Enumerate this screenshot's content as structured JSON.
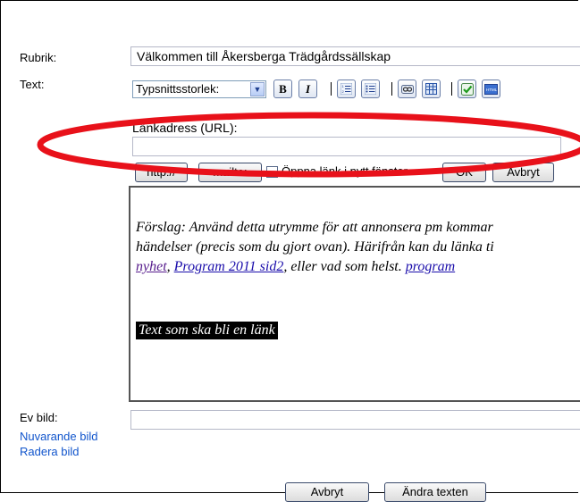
{
  "form": {
    "rubrik_label": "Rubrik:",
    "rubrik_value": "Välkommen till Åkersberga Trädgårdssällskap",
    "text_label": "Text:",
    "ev_bild_label": "Ev bild:",
    "nuvarande_bild_link": "Nuvarande bild",
    "radera_bild_link": "Radera bild",
    "ev_bild_value": ""
  },
  "toolbar": {
    "font_size_select": "Typsnittsstorlek:",
    "bold_label": "B",
    "italic_label": "I",
    "icons": [
      "ordered-list-icon",
      "unordered-list-icon",
      "link-icon",
      "table-icon",
      "check-icon",
      "html-icon"
    ]
  },
  "link_dialog": {
    "url_label": "Länkadress (URL):",
    "url_value": "",
    "http_button": "http://",
    "mailto_button": "mailto:",
    "new_window_label": "Öppna länk i nytt fönster",
    "ok_button": "OK",
    "cancel_button": "Avbryt"
  },
  "editor": {
    "line1": "Förslag: Använd detta utrymme för att annonsera pm kommar",
    "line2": "händelser (precis som du gjort ovan). Härifrån kan du länka ti",
    "link_nyhet": "nyhet",
    "sep1": ", ",
    "link_program2011": "Program 2011 sid2",
    "mid_text": ", eller vad som helst. ",
    "link_program": "program",
    "selected_text": "Text som ska bli en länk"
  },
  "footer": {
    "cancel_button": "Avbryt",
    "save_button": "Ändra texten"
  },
  "colors": {
    "annotation": "#e8111a",
    "link": "#1a0dab",
    "visited_link": "#551a8b"
  }
}
